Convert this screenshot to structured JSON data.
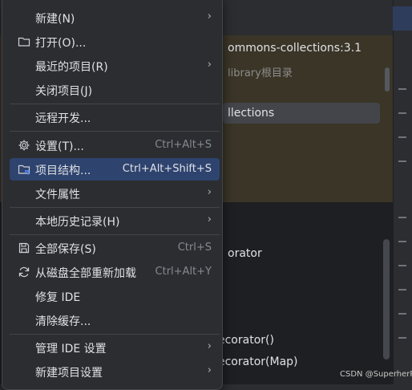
{
  "background": {
    "path_text": "ommons-collections:3.1",
    "sub_text": "library根目录",
    "selected_text": "llections",
    "code_lines": [
      "orator",
      "ecorator()",
      "ecorator(Map)"
    ]
  },
  "menu": {
    "items": [
      {
        "label": "新建(N)",
        "shortcut": "",
        "submenu": true,
        "icon": ""
      },
      {
        "label": "打开(O)...",
        "shortcut": "",
        "submenu": false,
        "icon": "folder-icon"
      },
      {
        "label": "最近的项目(R)",
        "shortcut": "",
        "submenu": true,
        "icon": ""
      },
      {
        "label": "关闭项目(J)",
        "shortcut": "",
        "submenu": false,
        "icon": ""
      },
      {
        "label": "远程开发...",
        "shortcut": "",
        "submenu": false,
        "icon": ""
      },
      {
        "label": "设置(T)...",
        "shortcut": "Ctrl+Alt+S",
        "submenu": false,
        "icon": "gear-icon"
      },
      {
        "label": "项目结构...",
        "shortcut": "Ctrl+Alt+Shift+S",
        "submenu": false,
        "icon": "project-structure-icon"
      },
      {
        "label": "文件属性",
        "shortcut": "",
        "submenu": true,
        "icon": ""
      },
      {
        "label": "本地历史记录(H)",
        "shortcut": "",
        "submenu": true,
        "icon": ""
      },
      {
        "label": "全部保存(S)",
        "shortcut": "Ctrl+S",
        "submenu": false,
        "icon": "save-icon"
      },
      {
        "label": "从磁盘全部重新加载",
        "shortcut": "Ctrl+Alt+Y",
        "submenu": false,
        "icon": "reload-icon"
      },
      {
        "label": "修复 IDE",
        "shortcut": "",
        "submenu": false,
        "icon": ""
      },
      {
        "label": "清除缓存...",
        "shortcut": "",
        "submenu": false,
        "icon": ""
      },
      {
        "label": "管理 IDE 设置",
        "shortcut": "",
        "submenu": true,
        "icon": ""
      },
      {
        "label": "新建项目设置",
        "shortcut": "",
        "submenu": true,
        "icon": ""
      }
    ],
    "arrow_glyph": "›"
  },
  "watermark": "CSDN @SuperherRo",
  "colors": {
    "menu_bg": "#2b2d30",
    "highlight": "#2e436e",
    "separator": "#43454a"
  }
}
